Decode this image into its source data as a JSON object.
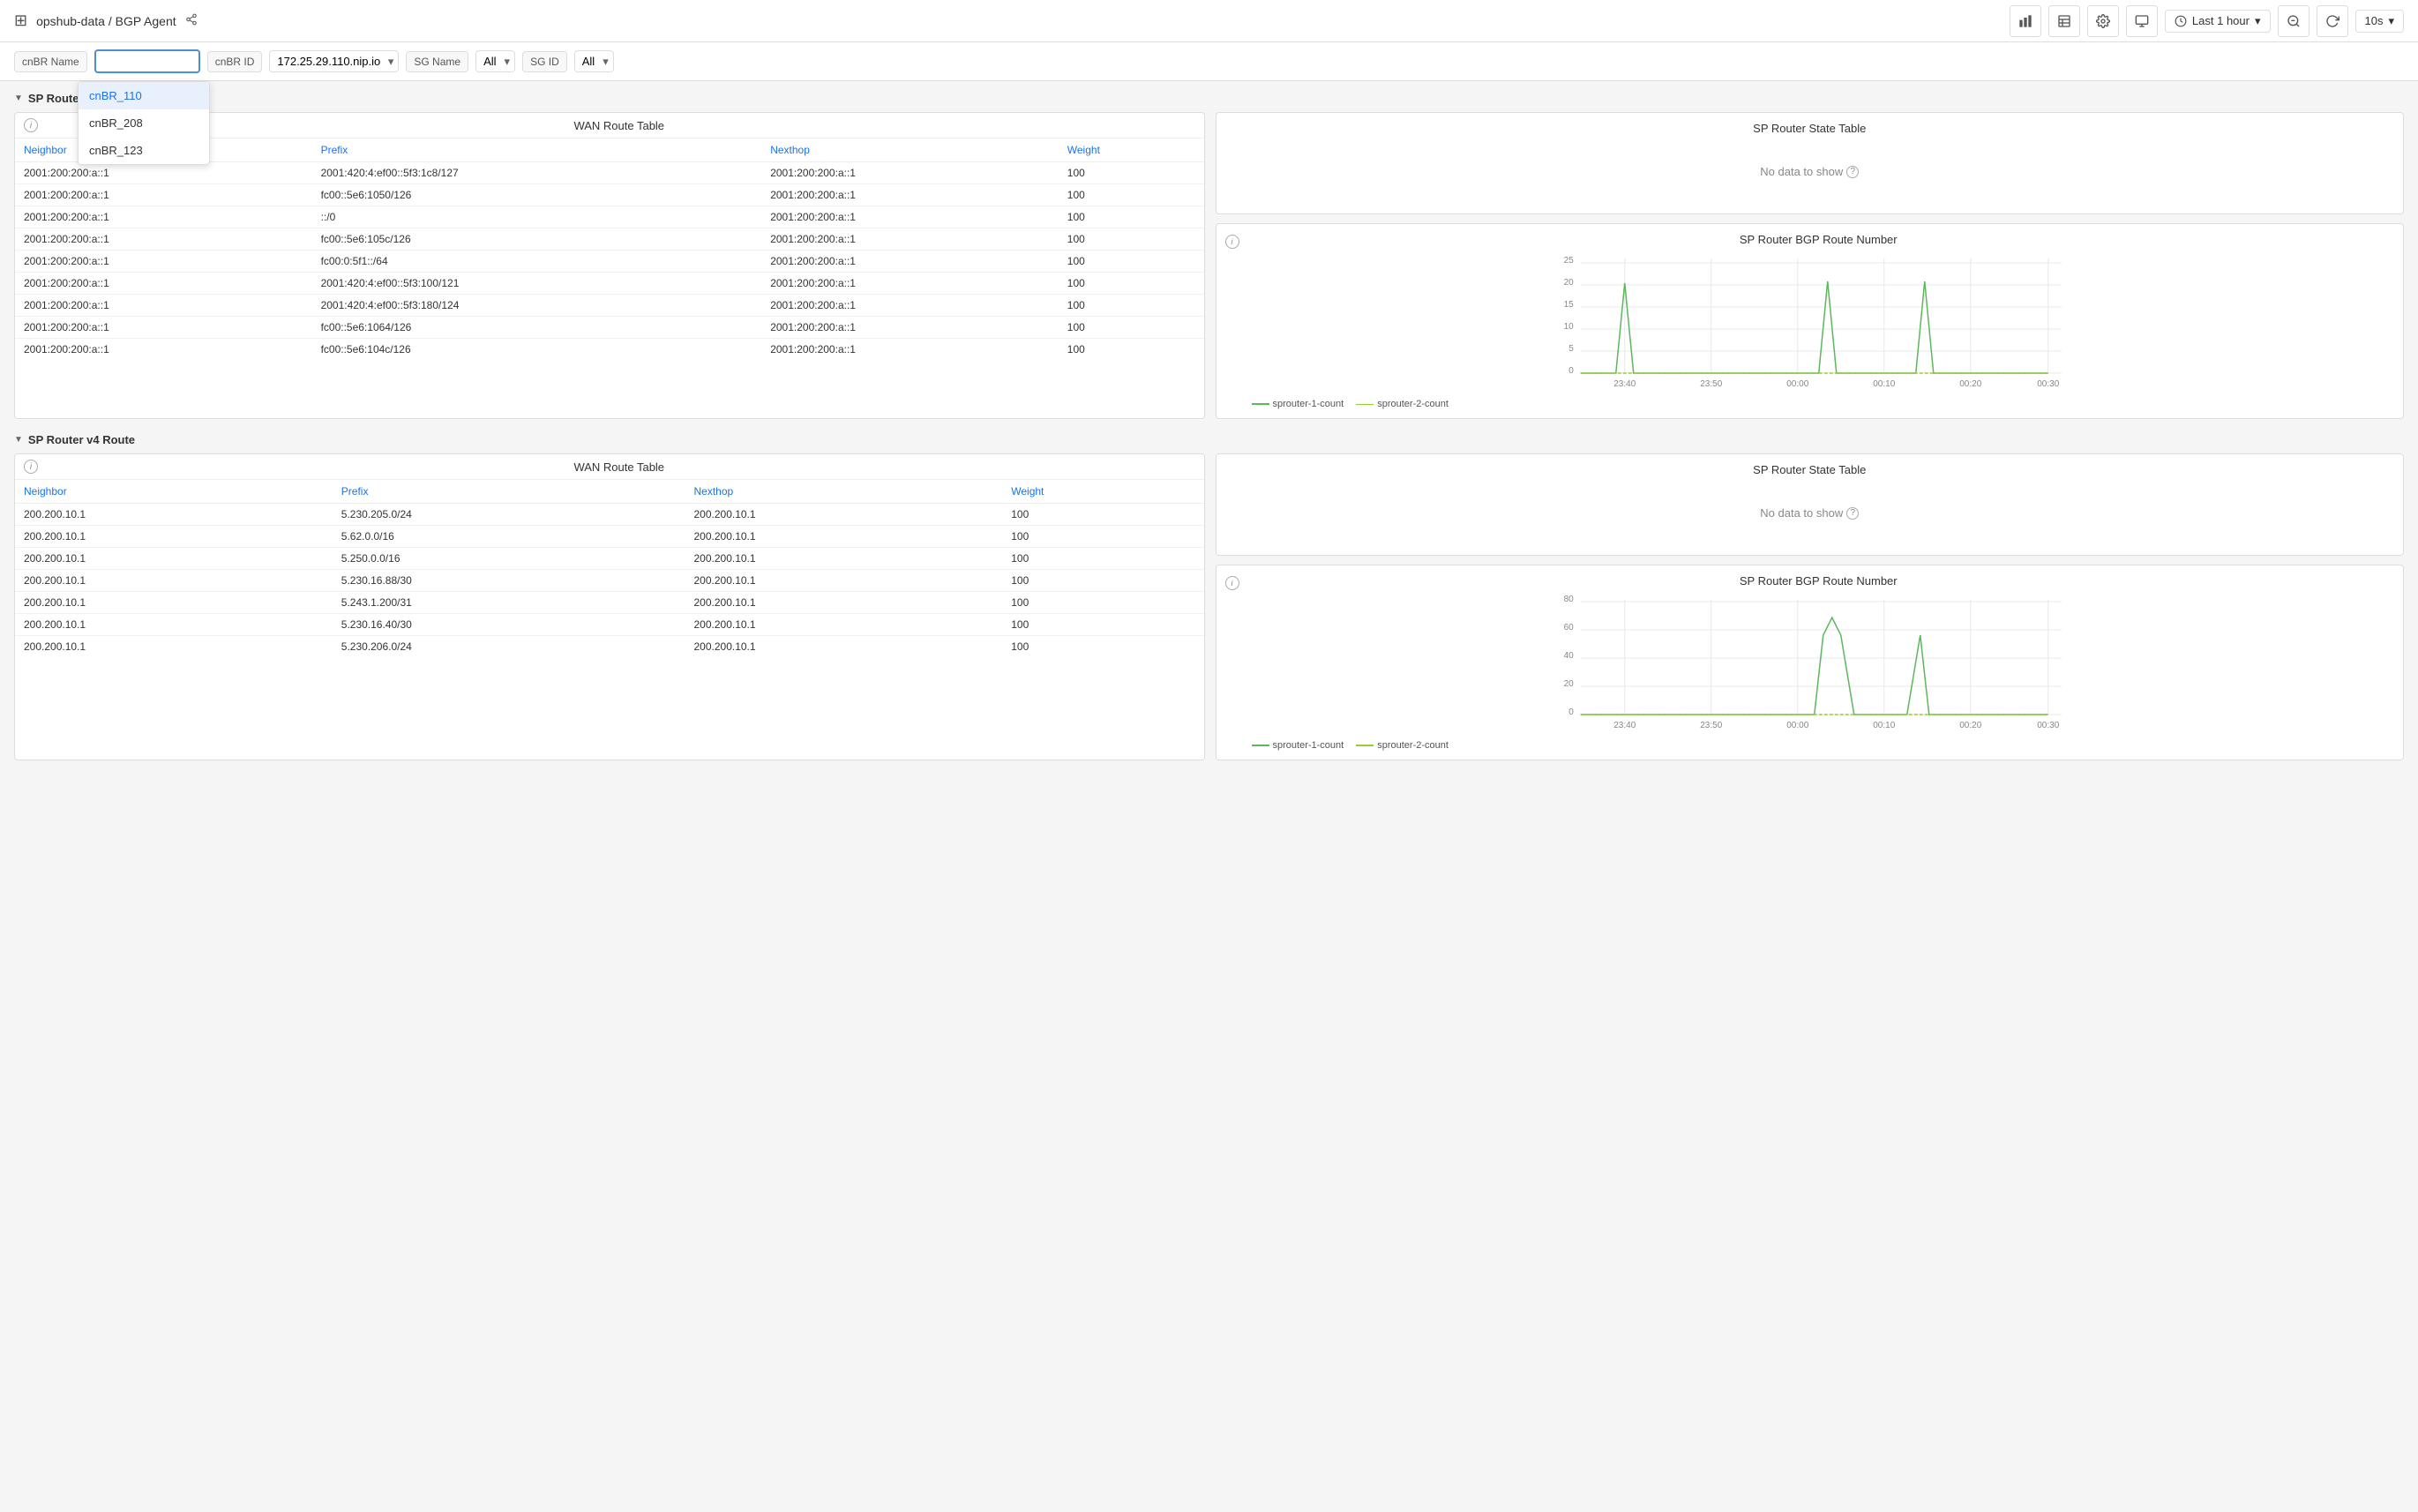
{
  "header": {
    "app_icon": "⊞",
    "breadcrumb": "opshub-data / BGP Agent",
    "share_icon": "share",
    "buttons": [
      "bar-chart",
      "table",
      "settings",
      "monitor"
    ],
    "time_label": "Last 1 hour",
    "zoom_out": "zoom-out",
    "refresh": "refresh",
    "interval": "10s"
  },
  "filters": {
    "cnbr_name_label": "cnBR Name",
    "cnbr_name_value": "",
    "cnbr_id_label": "cnBR ID",
    "cnbr_id_value": "172.25.29.110.nip.io",
    "sg_name_label": "SG Name",
    "sg_name_value": "All",
    "sg_id_label": "SG ID",
    "sg_id_value": "All"
  },
  "dropdown_items": [
    {
      "label": "cnBR_110",
      "active": true
    },
    {
      "label": "cnBR_208",
      "active": false
    },
    {
      "label": "cnBR_123",
      "active": false
    }
  ],
  "section_v6": {
    "title": "SP Router v6 Route",
    "table_title": "WAN Route Table",
    "columns": [
      "Neighbor",
      "Prefix",
      "Nexthop",
      "Weight"
    ],
    "rows": [
      {
        "neighbor": "2001:200:200:a::1",
        "prefix": "2001:420:4:ef00::5f3:1c8/127",
        "nexthop": "2001:200:200:a::1",
        "weight": "100"
      },
      {
        "neighbor": "2001:200:200:a::1",
        "prefix": "fc00::5e6:1050/126",
        "nexthop": "2001:200:200:a::1",
        "weight": "100"
      },
      {
        "neighbor": "2001:200:200:a::1",
        "prefix": "::/0",
        "nexthop": "2001:200:200:a::1",
        "weight": "100"
      },
      {
        "neighbor": "2001:200:200:a::1",
        "prefix": "fc00::5e6:105c/126",
        "nexthop": "2001:200:200:a::1",
        "weight": "100"
      },
      {
        "neighbor": "2001:200:200:a::1",
        "prefix": "fc00:0:5f1::/64",
        "nexthop": "2001:200:200:a::1",
        "weight": "100"
      },
      {
        "neighbor": "2001:200:200:a::1",
        "prefix": "2001:420:4:ef00::5f3:100/121",
        "nexthop": "2001:200:200:a::1",
        "weight": "100"
      },
      {
        "neighbor": "2001:200:200:a::1",
        "prefix": "2001:420:4:ef00::5f3:180/124",
        "nexthop": "2001:200:200:a::1",
        "weight": "100"
      },
      {
        "neighbor": "2001:200:200:a::1",
        "prefix": "fc00::5e6:1064/126",
        "nexthop": "2001:200:200:a::1",
        "weight": "100"
      },
      {
        "neighbor": "2001:200:200:a::1",
        "prefix": "fc00::5e6:104c/126",
        "nexthop": "2001:200:200:a::1",
        "weight": "100"
      }
    ],
    "state_table_title": "SP Router State Table",
    "no_data": "No data to show",
    "bgp_chart_title": "SP Router BGP Route Number",
    "chart_x_labels": [
      "23:40",
      "23:50",
      "00:00",
      "00:10",
      "00:20",
      "00:30"
    ],
    "chart_y_labels": [
      "0",
      "5",
      "10",
      "15",
      "20",
      "25"
    ],
    "legend": [
      {
        "label": "sprouter-1-count",
        "color": "#5cb85c"
      },
      {
        "label": "sprouter-2-count",
        "color": "#9acd32"
      }
    ]
  },
  "section_v4": {
    "title": "SP Router v4 Route",
    "table_title": "WAN Route Table",
    "columns": [
      "Neighbor",
      "Prefix",
      "Nexthop",
      "Weight"
    ],
    "rows": [
      {
        "neighbor": "200.200.10.1",
        "prefix": "5.230.205.0/24",
        "nexthop": "200.200.10.1",
        "weight": "100"
      },
      {
        "neighbor": "200.200.10.1",
        "prefix": "5.62.0.0/16",
        "nexthop": "200.200.10.1",
        "weight": "100"
      },
      {
        "neighbor": "200.200.10.1",
        "prefix": "5.250.0.0/16",
        "nexthop": "200.200.10.1",
        "weight": "100"
      },
      {
        "neighbor": "200.200.10.1",
        "prefix": "5.230.16.88/30",
        "nexthop": "200.200.10.1",
        "weight": "100"
      },
      {
        "neighbor": "200.200.10.1",
        "prefix": "5.243.1.200/31",
        "nexthop": "200.200.10.1",
        "weight": "100"
      },
      {
        "neighbor": "200.200.10.1",
        "prefix": "5.230.16.40/30",
        "nexthop": "200.200.10.1",
        "weight": "100"
      },
      {
        "neighbor": "200.200.10.1",
        "prefix": "5.230.206.0/24",
        "nexthop": "200.200.10.1",
        "weight": "100"
      }
    ],
    "state_table_title": "SP Router State Table",
    "no_data": "No data to show",
    "bgp_chart_title": "SP Router BGP Route Number",
    "chart_x_labels": [
      "23:40",
      "23:50",
      "00:00",
      "00:10",
      "00:20",
      "00:30"
    ],
    "chart_y_labels": [
      "0",
      "20",
      "40",
      "60",
      "80"
    ],
    "legend": [
      {
        "label": "sprouter-1-count",
        "color": "#5cb85c"
      },
      {
        "label": "sprouter-2-count",
        "color": "#9acd32"
      }
    ]
  }
}
